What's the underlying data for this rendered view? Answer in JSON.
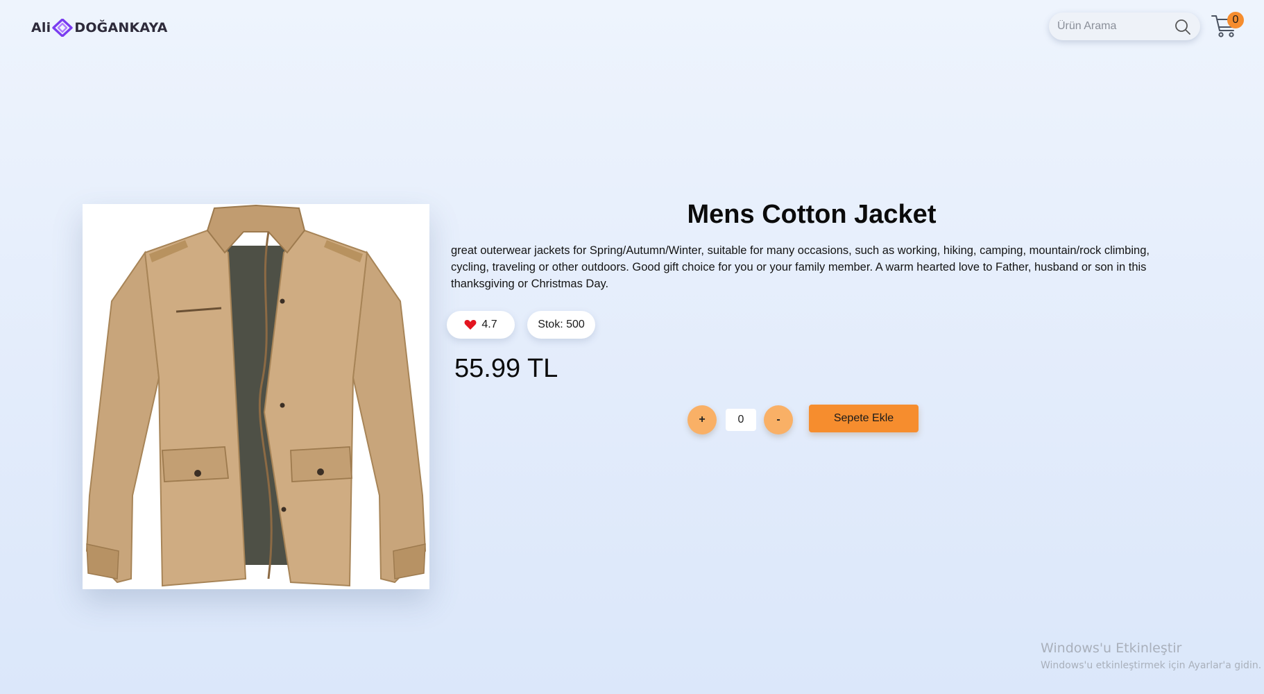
{
  "header": {
    "logo_left": "Ali",
    "logo_right": "DOĞANKAYA",
    "search": {
      "placeholder": "Ürün Arama",
      "value": ""
    },
    "cart": {
      "count": "0"
    }
  },
  "product": {
    "title": "Mens Cotton Jacket",
    "description": "great outerwear jackets for Spring/Autumn/Winter, suitable for many occasions, such as working, hiking, camping, mountain/rock climbing, cycling, traveling or other outdoors. Good gift choice for you or your family member. A warm hearted love to Father, husband or son in this thanksgiving or Christmas Day.",
    "rating": "4.7",
    "stock": "Stok: 500",
    "price": "55.99 TL",
    "image_icon": "jacket-image"
  },
  "quantity": {
    "plus_label": "+",
    "minus_label": "-",
    "value": "0"
  },
  "actions": {
    "add_to_cart_label": "Sepete Ekle"
  },
  "watermark": {
    "title": "Windows'u Etkinleştir",
    "subtitle": "Windows'u etkinleştirmek için Ayarlar'a gidin."
  },
  "colors": {
    "accent_orange": "#f68d2e",
    "qty_button": "#f9b066",
    "logo_purple": "#7a3cf0",
    "heart_red": "#e3141f"
  }
}
